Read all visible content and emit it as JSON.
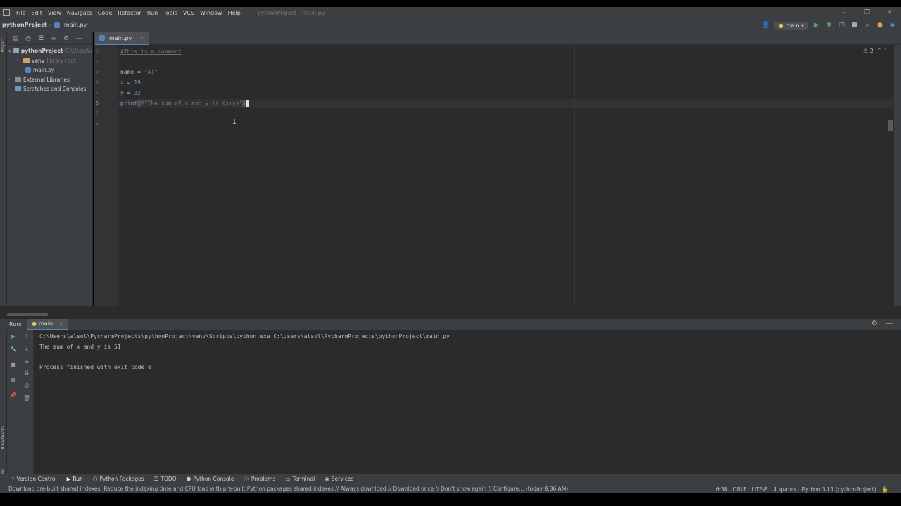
{
  "menubar": {
    "items": [
      "File",
      "Edit",
      "View",
      "Navigate",
      "Code",
      "Refactor",
      "Run",
      "Tools",
      "VCS",
      "Window",
      "Help"
    ],
    "window_title": "pythonProject - main.py"
  },
  "navbar": {
    "project": "pythonProject",
    "file": "main.py",
    "run_config": "main"
  },
  "left_strip": {
    "project": "Project",
    "bookmarks": "Bookmarks",
    "structure": "Structure"
  },
  "project_tree": {
    "root": "pythonProject",
    "root_hint": "C:\\Users\\a",
    "venv": "venv",
    "venv_hint": "library root",
    "main_file": "main.py",
    "external": "External Libraries",
    "scratches": "Scratches and Consoles"
  },
  "editor": {
    "tab_label": "main.py",
    "line_numbers": [
      "1",
      "2",
      "3",
      "4",
      "5",
      "6",
      "7",
      "8"
    ],
    "line1": "#This is a comment",
    "line3_var": "name",
    "line3_eq": " = ",
    "line3_str": "\"Al\"",
    "line4_var": "x",
    "line4_eq": " = ",
    "line4_num": "19",
    "line5_var": "y",
    "line5_eq": " = ",
    "line5_num": "32",
    "line6_fn": "print",
    "line6_open": "(",
    "line6_str": "f\"The sum of x and y is {x+y}\"",
    "line6_close": ")",
    "inspection_count": "2"
  },
  "run_panel": {
    "label": "Run:",
    "tab": "main",
    "output": [
      "C:\\Users\\alsol\\PycharmProjects\\pythonProject\\venv\\Scripts\\python.exe C:\\Users\\alsol\\PycharmProjects\\pythonProject\\main.py",
      "The sum of x and y is 51",
      "",
      "Process finished with exit code 0"
    ]
  },
  "bottom_tools": {
    "version_control": "Version Control",
    "run": "Run",
    "python_packages": "Python Packages",
    "todo": "TODO",
    "python_console": "Python Console",
    "problems": "Problems",
    "terminal": "Terminal",
    "services": "Services"
  },
  "statusbar": {
    "message": "Download pre-built shared indexes: Reduce the indexing time and CPU load with pre-built Python packages shared indexes // Always download // Download once // Don't show again // Configure... (today 8:36 AM)",
    "position": "6:38",
    "line_sep": "CRLF",
    "encoding": "UTF-8",
    "indent": "4 spaces",
    "interpreter": "Python 3.11 (pythonProject)"
  },
  "colors": {
    "comment": "#808080",
    "string": "#6a8759",
    "number": "#6897bb",
    "builtin": "#8888c6",
    "accent": "#4a88c7"
  }
}
